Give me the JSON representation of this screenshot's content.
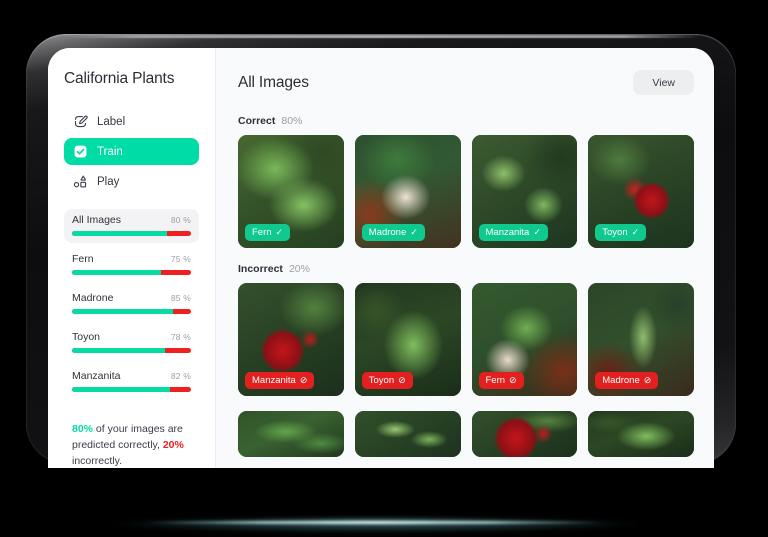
{
  "app": {
    "title": "California Plants"
  },
  "sidebar": {
    "nav": [
      {
        "label": "Label",
        "icon": "pencil-square-icon",
        "active": false
      },
      {
        "label": "Train",
        "icon": "checkbox-checked-icon",
        "active": true
      },
      {
        "label": "Play",
        "icon": "shapes-icon",
        "active": false
      }
    ],
    "metrics": [
      {
        "name": "All Images",
        "percent_label": "80 %",
        "percent": 80,
        "selected": true
      },
      {
        "name": "Fern",
        "percent_label": "75 %",
        "percent": 75,
        "selected": false
      },
      {
        "name": "Madrone",
        "percent_label": "85 %",
        "percent": 85,
        "selected": false
      },
      {
        "name": "Toyon",
        "percent_label": "78 %",
        "percent": 78,
        "selected": false
      },
      {
        "name": "Manzanita",
        "percent_label": "82 %",
        "percent": 82,
        "selected": false
      }
    ],
    "summary": {
      "correct_pct": "80%",
      "middle_text": " of your images are predicted correctly, ",
      "incorrect_pct": "20%",
      "end_text": " incorrectly."
    },
    "colors": {
      "accent_green": "#00dca6",
      "bar_green": "#06dba4",
      "bar_red": "#ef2020",
      "selected_bg": "#f3f3f5"
    }
  },
  "main": {
    "title": "All Images",
    "view_button": "View",
    "sections": [
      {
        "name": "Correct",
        "percent_label": "80%",
        "tiles": [
          {
            "label": "Fern",
            "status": "correct",
            "glyph": "✓",
            "photo": "bg-fern-a"
          },
          {
            "label": "Madrone",
            "status": "correct",
            "glyph": "✓",
            "photo": "bg-madrone"
          },
          {
            "label": "Manzanita",
            "status": "correct",
            "glyph": "✓",
            "photo": "bg-manzanita"
          },
          {
            "label": "Toyon",
            "status": "correct",
            "glyph": "✓",
            "photo": "bg-toyon-berry"
          }
        ]
      },
      {
        "name": "Incorrect",
        "percent_label": "20%",
        "tiles": [
          {
            "label": "Manzanita",
            "status": "incorrect",
            "glyph": "⊘",
            "photo": "bg-toyon-berry2"
          },
          {
            "label": "Toyon",
            "status": "incorrect",
            "glyph": "⊘",
            "photo": "bg-fern-dark"
          },
          {
            "label": "Fern",
            "status": "incorrect",
            "glyph": "⊘",
            "photo": "bg-madrone-leaf"
          },
          {
            "label": "Madrone",
            "status": "incorrect",
            "glyph": "⊘",
            "photo": "bg-manzanita-stem"
          }
        ]
      }
    ],
    "partial_row": [
      {
        "photo": "bg-madrone-broad"
      },
      {
        "photo": "bg-manzanita-bush"
      },
      {
        "photo": "bg-toyon-berry2"
      },
      {
        "photo": "bg-fern-dark"
      }
    ]
  }
}
